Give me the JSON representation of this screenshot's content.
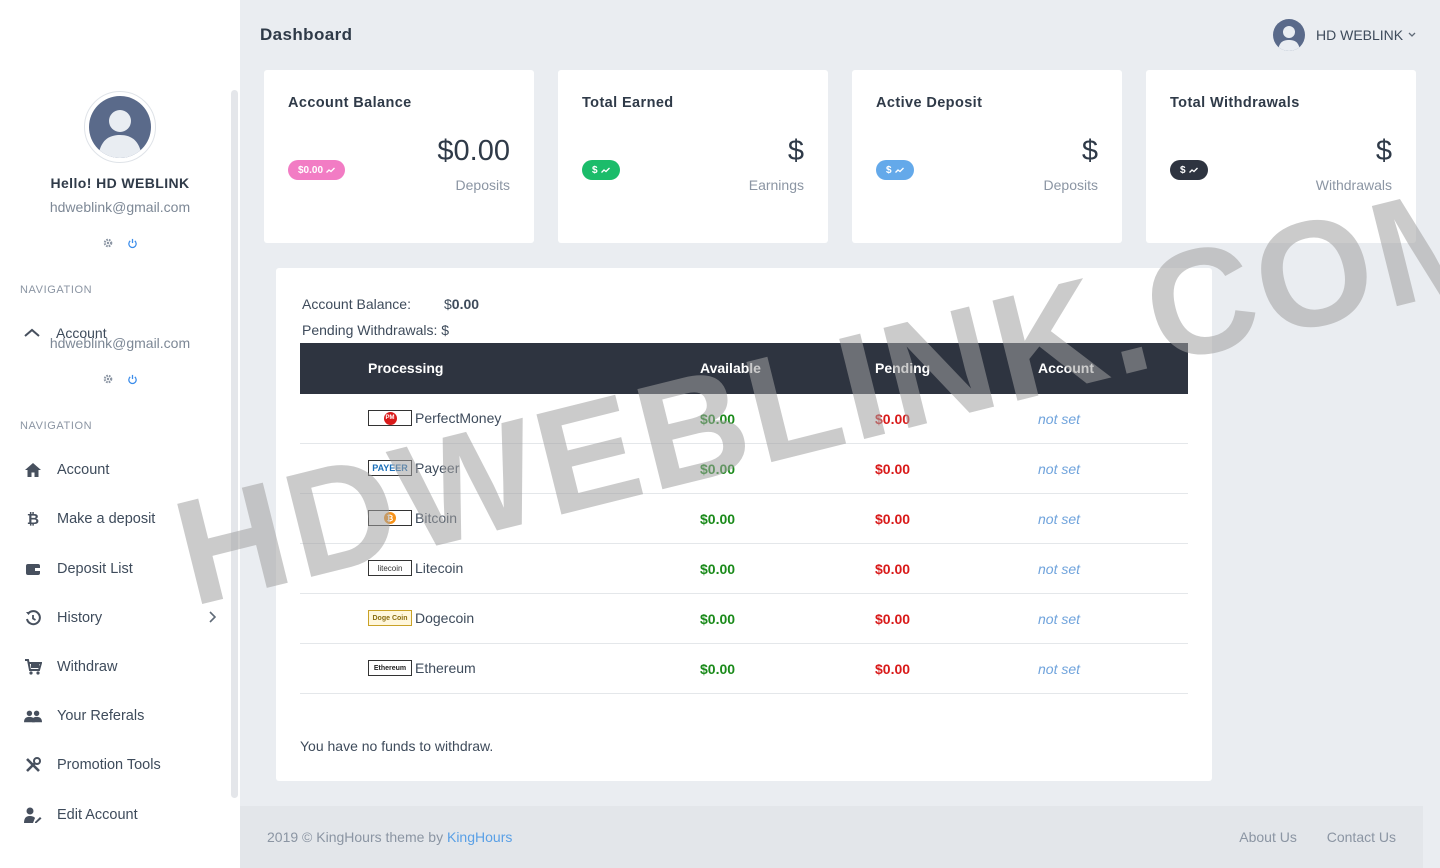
{
  "header": {
    "title": "Dashboard",
    "user_name": "HD WEBLINK"
  },
  "sidebar": {
    "greeting": "Hello! HD WEBLINK",
    "email": "hdweblink@gmail.com",
    "nav_heading": "NAVIGATION",
    "ghost_item": "Account",
    "items": [
      {
        "label": "Account",
        "icon": "home-icon"
      },
      {
        "label": "Make a deposit",
        "icon": "bitcoin-icon"
      },
      {
        "label": "Deposit List",
        "icon": "wallet-icon"
      },
      {
        "label": "History",
        "icon": "history-icon"
      },
      {
        "label": "Withdraw",
        "icon": "cart-icon"
      },
      {
        "label": "Your Referals",
        "icon": "users-icon"
      },
      {
        "label": "Promotion Tools",
        "icon": "tools-icon"
      },
      {
        "label": "Edit Account",
        "icon": "user-edit-icon"
      }
    ]
  },
  "cards": [
    {
      "title": "Account Balance",
      "value": "$0.00",
      "sub": "Deposits",
      "badge": "$0.00",
      "color": "#f27cc4"
    },
    {
      "title": "Total Earned",
      "value": "$",
      "sub": "Earnings",
      "badge": "$",
      "color": "#1bbc6a"
    },
    {
      "title": "Active Deposit",
      "value": "$",
      "sub": "Deposits",
      "badge": "$",
      "color": "#64a9ea"
    },
    {
      "title": "Total Withdrawals",
      "value": "$",
      "sub": "Withdrawals",
      "badge": "$",
      "color": "#2e3440"
    }
  ],
  "panel": {
    "balance_label": "Account Balance:",
    "balance_currency": "$",
    "balance_value": "0.00",
    "pending_label": "Pending Withdrawals: $",
    "columns": [
      "Processing",
      "Available",
      "Pending",
      "Account"
    ],
    "rows": [
      {
        "name": "PerfectMoney",
        "logo": "PM",
        "available": "$0.00",
        "pending": "$0.00",
        "account": "not set"
      },
      {
        "name": "Payeer",
        "logo": "PAYEER",
        "available": "$0.00",
        "pending": "$0.00",
        "account": "not set"
      },
      {
        "name": "Bitcoin",
        "logo": "₿",
        "available": "$0.00",
        "pending": "$0.00",
        "account": "not set"
      },
      {
        "name": "Litecoin",
        "logo": "litecoin",
        "available": "$0.00",
        "pending": "$0.00",
        "account": "not set"
      },
      {
        "name": "Dogecoin",
        "logo": "Doge Coin",
        "available": "$0.00",
        "pending": "$0.00",
        "account": "not set"
      },
      {
        "name": "Ethereum",
        "logo": "Ethereum",
        "available": "$0.00",
        "pending": "$0.00",
        "account": "not set"
      }
    ],
    "no_funds": "You have no funds to withdraw."
  },
  "watermark": "HDWEBLINK.COM",
  "footer": {
    "copyright": "2019 © KingHours theme by ",
    "brand_link": "KingHours",
    "about": "About Us",
    "contact": "Contact Us"
  }
}
